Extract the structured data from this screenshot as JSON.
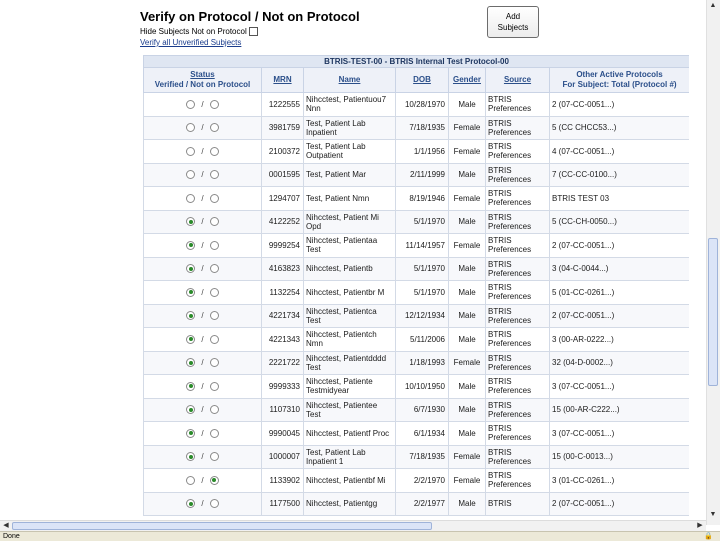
{
  "header": {
    "title": "Verify on Protocol / Not on Protocol",
    "hide_label": "Hide Subjects Not on Protocol",
    "verify_link": "Verify all Unverified Subjects",
    "add_button": "Add Subjects"
  },
  "table": {
    "caption": "BTRIS-TEST-00 - BTRIS Internal Test Protocol-00",
    "columns": {
      "status": "Status",
      "status_sub": "Verified / Not on Protocol",
      "mrn": "MRN",
      "name": "Name",
      "dob": "DOB",
      "gender": "Gender",
      "source": "Source",
      "other": "Other Active Protocols",
      "other_sub": "For Subject: Total (Protocol #)"
    },
    "rows": [
      {
        "mrn": "1222555",
        "name": "Nihcctest, Patientuou7 Nnn",
        "dob": "10/28/1970",
        "gender": "Male",
        "source": "BTRIS Preferences",
        "other": "2 (07-CC-0051...)"
      },
      {
        "mrn": "3981759",
        "name": "Test, Patient Lab Inpatient",
        "dob": "7/18/1935",
        "gender": "Female",
        "source": "BTRIS Preferences",
        "other": "5 (CC CHCC53...)"
      },
      {
        "mrn": "2100372",
        "name": "Test, Patient Lab Outpatient",
        "dob": "1/1/1956",
        "gender": "Female",
        "source": "BTRIS Preferences",
        "other": "4 (07-CC-0051...)"
      },
      {
        "mrn": "0001595",
        "name": "Test, Patient Mar",
        "dob": "2/11/1999",
        "gender": "Male",
        "source": "BTRIS Preferences",
        "other": "7 (CC-CC-0100...)"
      },
      {
        "mrn": "1294707",
        "name": "Test, Patient Nmn",
        "dob": "8/19/1946",
        "gender": "Female",
        "source": "BTRIS Preferences",
        "other": "BTRIS TEST 03"
      },
      {
        "mrn": "4122252",
        "name": "Nihcctest, Patient Mi Opd",
        "dob": "5/1/1970",
        "gender": "Male",
        "source": "BTRIS Preferences",
        "other": "5 (CC-CH-0050...)"
      },
      {
        "mrn": "9999254",
        "name": "Nihcctest, Patientaa Test",
        "dob": "11/14/1957",
        "gender": "Female",
        "source": "BTRIS Preferences",
        "other": "2 (07-CC-0051...)"
      },
      {
        "mrn": "4163823",
        "name": "Nihcctest, Patientb",
        "dob": "5/1/1970",
        "gender": "Male",
        "source": "BTRIS Preferences",
        "other": "3 (04-C-0044...)"
      },
      {
        "mrn": "1132254",
        "name": "Nihcctest, Patientbr M",
        "dob": "5/1/1970",
        "gender": "Male",
        "source": "BTRIS Preferences",
        "other": "5 (01-CC-0261...)"
      },
      {
        "mrn": "4221734",
        "name": "Nihcctest, Patientca Test",
        "dob": "12/12/1934",
        "gender": "Male",
        "source": "BTRIS Preferences",
        "other": "2 (07-CC-0051...)"
      },
      {
        "mrn": "4221343",
        "name": "Nihcctest, Patientch Nmn",
        "dob": "5/11/2006",
        "gender": "Male",
        "source": "BTRIS Preferences",
        "other": "3 (00-AR-0222...)"
      },
      {
        "mrn": "2221722",
        "name": "Nihcctest, Patientdddd Test",
        "dob": "1/18/1993",
        "gender": "Female",
        "source": "BTRIS Preferences",
        "other": "32 (04-D-0002...)"
      },
      {
        "mrn": "9999333",
        "name": "Nihcctest, Patiente Testmidyear",
        "dob": "10/10/1950",
        "gender": "Male",
        "source": "BTRIS Preferences",
        "other": "3 (07-CC-0051...)"
      },
      {
        "mrn": "1107310",
        "name": "Nihcctest, Patientee Test",
        "dob": "6/7/1930",
        "gender": "Male",
        "source": "BTRIS Preferences",
        "other": "15 (00-AR-C222...)"
      },
      {
        "mrn": "9990045",
        "name": "Nihcctest, Patientf Proc",
        "dob": "6/1/1934",
        "gender": "Male",
        "source": "BTRIS Preferences",
        "other": "3 (07-CC-0051...)"
      },
      {
        "mrn": "1000007",
        "name": "Test, Patient Lab Inpatient 1",
        "dob": "7/18/1935",
        "gender": "Female",
        "source": "BTRIS Preferences",
        "other": "15 (00-C-0013...)"
      },
      {
        "mrn": "1133902",
        "name": "Nihcctest, Patientbf Mi",
        "dob": "2/2/1970",
        "gender": "Female",
        "source": "BTRIS Preferences",
        "other": "3 (01-CC-0261...)"
      },
      {
        "mrn": "1177500",
        "name": "Nihcctest, Patientgg",
        "dob": "2/2/1977",
        "gender": "Male",
        "source": "BTRIS",
        "other": "2 (07-CC-0051...)"
      }
    ],
    "states": [
      "none",
      "none",
      "none",
      "none",
      "none",
      "verified",
      "verified",
      "verified",
      "verified",
      "verified",
      "verified",
      "verified",
      "verified",
      "verified",
      "verified",
      "verified",
      "not",
      "verified"
    ]
  },
  "statusbar": {
    "text": "Done"
  },
  "colors": {
    "link": "#2b4f8a",
    "header_bg": "#eef1f8",
    "selected": "#2a8a2a"
  }
}
